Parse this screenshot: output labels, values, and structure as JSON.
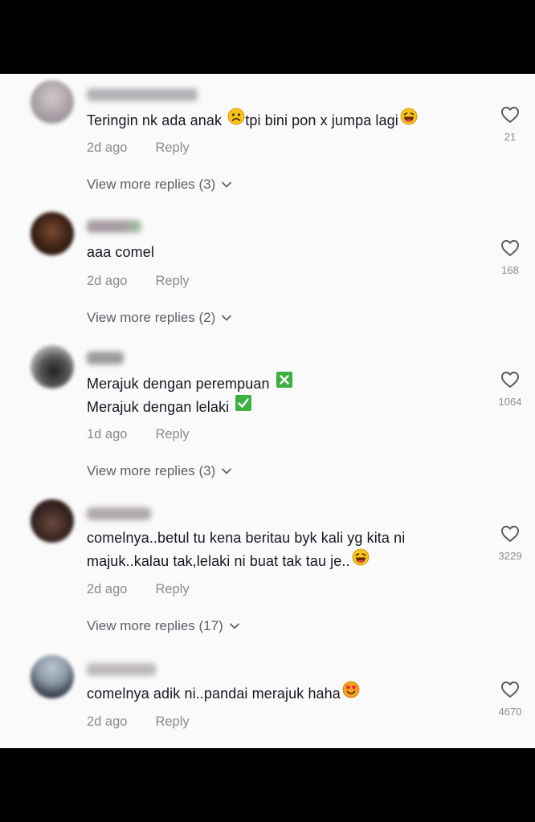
{
  "comments": [
    {
      "lines": [
        "Teringin nk ada anak",
        "tpi bini pon x jumpa lagi"
      ],
      "emojis": [
        "sad-face-emoji",
        "laughing-face-emoji"
      ],
      "time": "2d ago",
      "reply": "Reply",
      "likes": "21",
      "more_replies": "View more replies (3)"
    },
    {
      "lines": [
        "aaa comel"
      ],
      "time": "2d ago",
      "reply": "Reply",
      "likes": "168",
      "more_replies": "View more replies (2)"
    },
    {
      "lines": [
        "Merajuk dengan perempuan",
        "Merajuk dengan lelaki"
      ],
      "emojis": [
        "cross-mark-emoji",
        "check-mark-emoji"
      ],
      "time": "1d ago",
      "reply": "Reply",
      "likes": "1064",
      "more_replies": "View more replies (3)"
    },
    {
      "lines": [
        "comelnya..betul tu kena beritau byk kali yg kita ni",
        "majuk..kalau tak,lelaki ni buat tak tau je.."
      ],
      "emojis": [
        "laughing-face-emoji"
      ],
      "time": "2d ago",
      "reply": "Reply",
      "likes": "3229",
      "more_replies": "View more replies (17)"
    },
    {
      "lines": [
        "comelnya adik ni..pandai merajuk haha"
      ],
      "emojis": [
        "heart-eyes-emoji"
      ],
      "time": "2d ago",
      "reply": "Reply",
      "likes": "4670"
    }
  ],
  "colors": {
    "background": "#fafafa",
    "text": "#161823",
    "muted": "#8a8b91",
    "emoji_yellow": "#f7c21c",
    "check_green": "#3cb043"
  }
}
